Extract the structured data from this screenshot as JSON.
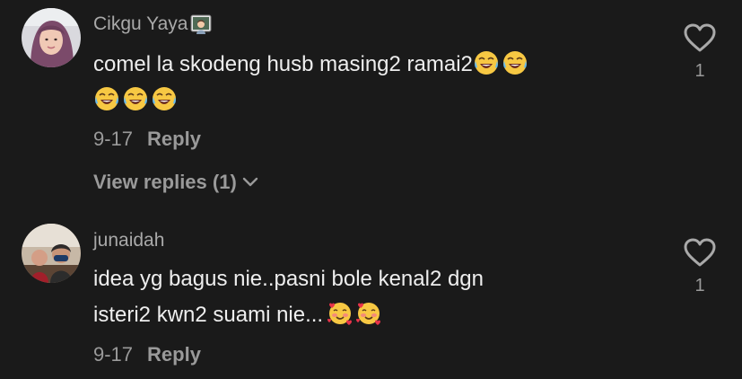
{
  "comments": [
    {
      "username": "Cikgu Yaya",
      "username_badge_icon": "teacher-emoji-icon",
      "text_line1": "comel la skodeng husb masing2 ramai2",
      "text_line2": "",
      "emojis_line1": [
        "joy-emoji-icon",
        "joy-emoji-icon"
      ],
      "emojis_line2": [
        "joy-emoji-icon",
        "joy-emoji-icon",
        "joy-emoji-icon"
      ],
      "date": "9-17",
      "reply_label": "Reply",
      "view_replies_label": "View replies (1)",
      "likes": "1",
      "like_icon": "heart-outline-icon"
    },
    {
      "username": "junaidah",
      "text_line1": "idea yg bagus nie..pasni bole kenal2 dgn",
      "text_line2": "isteri2 kwn2 suami nie...",
      "emojis_line2": [
        "smiling-face-with-hearts-icon",
        "smiling-face-with-hearts-icon"
      ],
      "date": "9-17",
      "reply_label": "Reply",
      "likes": "1",
      "like_icon": "heart-outline-icon"
    }
  ],
  "colors": {
    "background": "#1a1a1a",
    "username": "#a9a9a9",
    "text": "#eeeeee",
    "meta": "#9a9a9a"
  }
}
